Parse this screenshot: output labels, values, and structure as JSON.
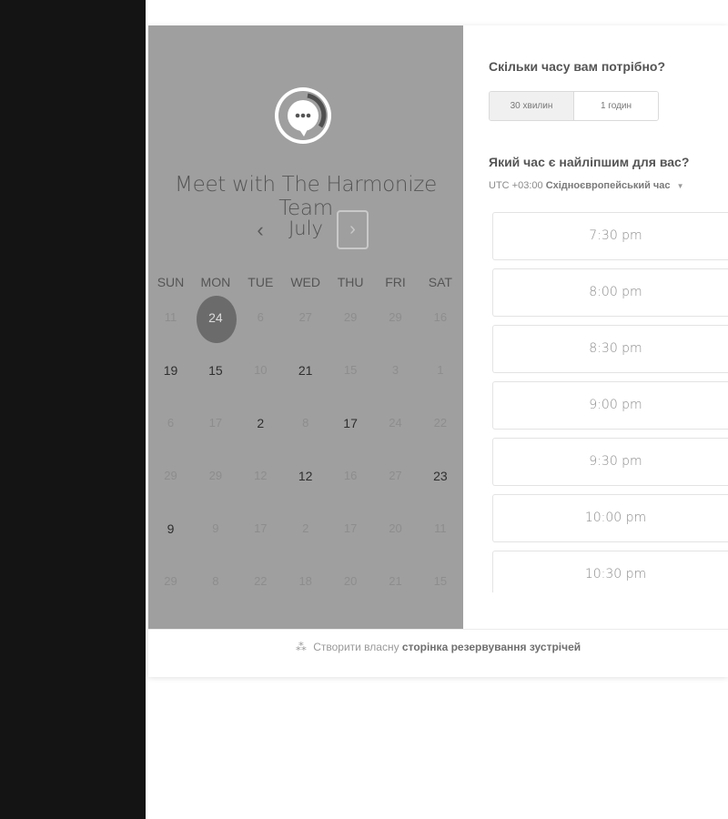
{
  "organizer": {
    "title": "Meet with The Harmonize Team",
    "avatar_icon": "chat-bubble-icon"
  },
  "calendar": {
    "month": "July",
    "prev_symbol": "‹",
    "next_symbol": "›",
    "weekdays": [
      "SUN",
      "MON",
      "TUE",
      "WED",
      "THU",
      "FRI",
      "SAT"
    ],
    "weeks": [
      [
        {
          "d": "11",
          "active": false
        },
        {
          "d": "24",
          "active": true,
          "selected": true
        },
        {
          "d": "6",
          "active": false
        },
        {
          "d": "27",
          "active": false
        },
        {
          "d": "29",
          "active": false
        },
        {
          "d": "29",
          "active": false
        },
        {
          "d": "16",
          "active": false
        }
      ],
      [
        {
          "d": "19",
          "active": true
        },
        {
          "d": "15",
          "active": true
        },
        {
          "d": "10",
          "active": false
        },
        {
          "d": "21",
          "active": true
        },
        {
          "d": "15",
          "active": false
        },
        {
          "d": "3",
          "active": false
        },
        {
          "d": "1",
          "active": false
        }
      ],
      [
        {
          "d": "6",
          "active": false
        },
        {
          "d": "17",
          "active": false
        },
        {
          "d": "2",
          "active": true
        },
        {
          "d": "8",
          "active": false
        },
        {
          "d": "17",
          "active": true
        },
        {
          "d": "24",
          "active": false
        },
        {
          "d": "22",
          "active": false
        }
      ],
      [
        {
          "d": "29",
          "active": false
        },
        {
          "d": "29",
          "active": false
        },
        {
          "d": "12",
          "active": false
        },
        {
          "d": "12",
          "active": true
        },
        {
          "d": "16",
          "active": false
        },
        {
          "d": "27",
          "active": false
        },
        {
          "d": "23",
          "active": true
        }
      ],
      [
        {
          "d": "9",
          "active": true
        },
        {
          "d": "9",
          "active": false
        },
        {
          "d": "17",
          "active": false
        },
        {
          "d": "2",
          "active": false
        },
        {
          "d": "17",
          "active": false
        },
        {
          "d": "20",
          "active": false
        },
        {
          "d": "11",
          "active": false
        }
      ],
      [
        {
          "d": "29",
          "active": false
        },
        {
          "d": "8",
          "active": false
        },
        {
          "d": "22",
          "active": false
        },
        {
          "d": "18",
          "active": false
        },
        {
          "d": "20",
          "active": false
        },
        {
          "d": "21",
          "active": false
        },
        {
          "d": "15",
          "active": false
        }
      ]
    ]
  },
  "booking": {
    "duration_question": "Скільки часу вам потрібно?",
    "durations": [
      "30 хвилин",
      "1 годин"
    ],
    "time_question": "Який час є найліпшим для вас?",
    "timezone_offset": "UTC +03:00",
    "timezone_name": "Східноєвропейський час",
    "slots": [
      "7:30 pm",
      "8:00 pm",
      "8:30 pm",
      "9:00 pm",
      "9:30 pm",
      "10:00 pm",
      "10:30 pm"
    ]
  },
  "footer": {
    "prefix": "Створити власну",
    "link": "сторінка резервування зустрічей",
    "icon": "hubspot-sprocket-icon"
  }
}
